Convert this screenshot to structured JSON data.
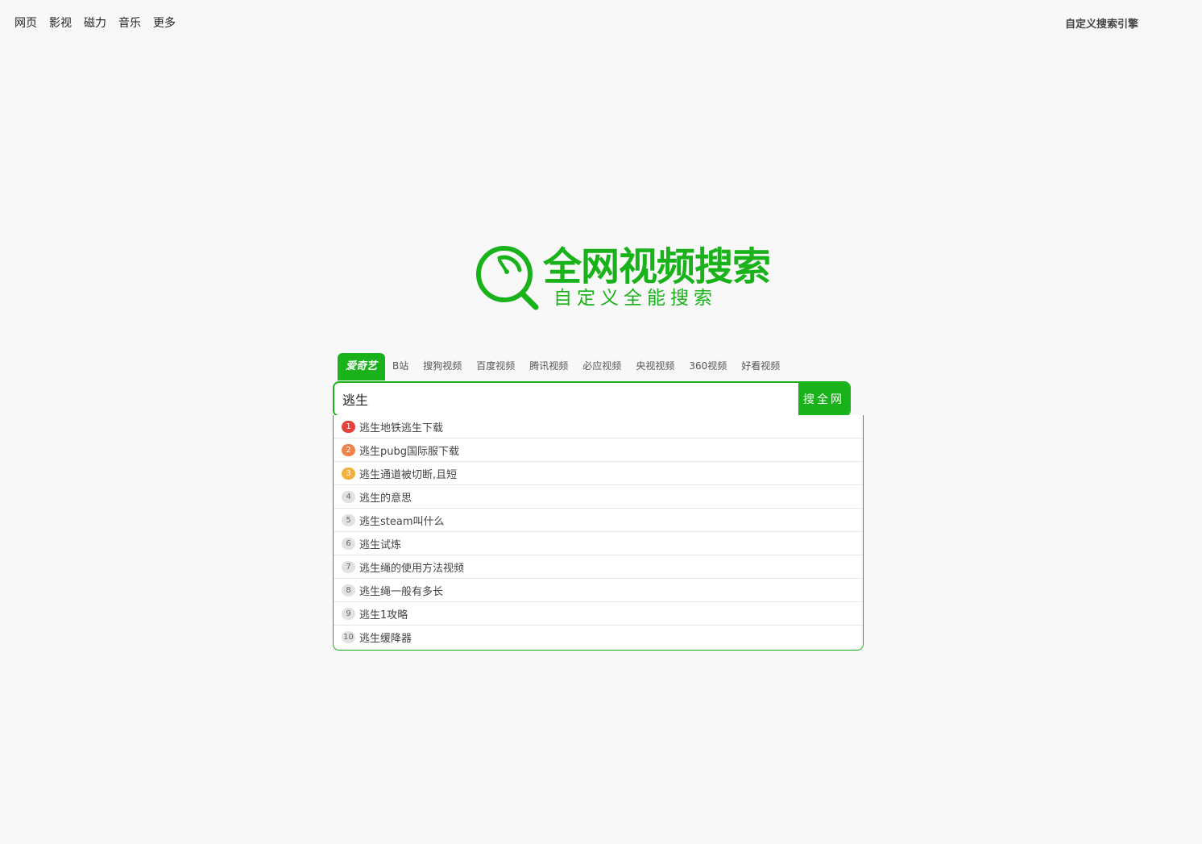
{
  "topnav": {
    "items": [
      "网页",
      "影视",
      "磁力",
      "音乐",
      "更多"
    ],
    "right_link": "自定义搜索引擎"
  },
  "logo": {
    "title": "全网视频搜索",
    "subtitle": "自定义全能搜索",
    "icon": "magnifier-icon",
    "color": "#1ab21a"
  },
  "tabs": [
    "爱奇艺",
    "B站",
    "搜狗视频",
    "百度视频",
    "腾讯视频",
    "必应视频",
    "央视视频",
    "360视频",
    "好看视频"
  ],
  "active_tab_index": 0,
  "search": {
    "value": "逃生",
    "button_label": "搜全网"
  },
  "suggestions": [
    {
      "rank": "1",
      "text": "逃生地铁逃生下载"
    },
    {
      "rank": "2",
      "text": "逃生pubg国际服下载"
    },
    {
      "rank": "3",
      "text": "逃生通道被切断,且短"
    },
    {
      "rank": "4",
      "text": "逃生的意思"
    },
    {
      "rank": "5",
      "text": "逃生steam叫什么"
    },
    {
      "rank": "6",
      "text": "逃生试炼"
    },
    {
      "rank": "7",
      "text": "逃生绳的使用方法视频"
    },
    {
      "rank": "8",
      "text": "逃生绳一般有多长"
    },
    {
      "rank": "9",
      "text": "逃生1攻略"
    },
    {
      "rank": "10",
      "text": "逃生缓降器"
    }
  ],
  "colors": {
    "accent": "#1ab21a",
    "rank1": "#e8413c",
    "rank2": "#f0824a",
    "rank3": "#f4b03e",
    "background": "#f8f8f8"
  }
}
